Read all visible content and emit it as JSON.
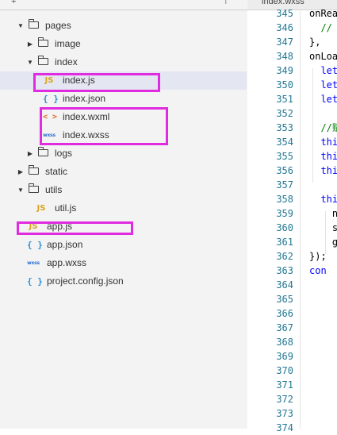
{
  "explorer": {
    "tree": [
      {
        "label": "pages",
        "type": "folder",
        "expanded": true,
        "depth": 1
      },
      {
        "label": "image",
        "type": "folder",
        "expanded": false,
        "depth": 2
      },
      {
        "label": "index",
        "type": "folder",
        "expanded": true,
        "depth": 2
      },
      {
        "label": "index.js",
        "type": "js",
        "icon": "JS",
        "depth": 3,
        "selected": true
      },
      {
        "label": "index.json",
        "type": "json",
        "icon": "{ }",
        "depth": 3
      },
      {
        "label": "index.wxml",
        "type": "wxml",
        "icon": "< >",
        "depth": 3
      },
      {
        "label": "index.wxss",
        "type": "wxss",
        "icon": "wxss",
        "depth": 3
      },
      {
        "label": "logs",
        "type": "folder",
        "expanded": false,
        "depth": 2
      },
      {
        "label": "static",
        "type": "folder",
        "expanded": false,
        "depth": 1
      },
      {
        "label": "utils",
        "type": "folder",
        "expanded": true,
        "depth": 1
      },
      {
        "label": "util.js",
        "type": "js",
        "icon": "JS",
        "depth": 2
      },
      {
        "label": "app.js",
        "type": "js",
        "icon": "JS",
        "depth": 1
      },
      {
        "label": "app.json",
        "type": "json",
        "icon": "{ }",
        "depth": 1
      },
      {
        "label": "app.wxss",
        "type": "wxss",
        "icon": "wxss",
        "depth": 1
      },
      {
        "label": "project.config.json",
        "type": "json",
        "icon": "{ }",
        "depth": 1
      }
    ]
  },
  "editor": {
    "tab_label": "index.wxss",
    "line_numbers": [
      "345",
      "346",
      "347",
      "348",
      "349",
      "350",
      "351",
      "352",
      "353",
      "354",
      "355",
      "356",
      "357",
      "358",
      "359",
      "360",
      "361",
      "362",
      "363",
      "364",
      "365",
      "366",
      "367",
      "368",
      "369",
      "370",
      "371",
      "372",
      "373",
      "374"
    ],
    "code_lines": [
      "onRea",
      "  //",
      "},",
      "onLoa",
      "  let",
      "  let",
      "  let",
      "",
      "  //赋",
      "  thi",
      "  thi",
      "  thi",
      "",
      "  thi",
      "    n",
      "    s",
      "    g",
      "});",
      "con",
      "",
      "  ",
      "  ",
      "",
      "  ",
      "  ",
      "",
      "  ",
      "  ",
      "",
      ""
    ]
  },
  "colors": {
    "highlight_box": "#e02be0",
    "js_icon": "#d9a521",
    "json_icon": "#2b8fd6",
    "wxml_icon": "#e36b21",
    "wxss_icon": "#2b6fd6",
    "line_number": "#237893",
    "selected_row": "#e4e6f1"
  }
}
